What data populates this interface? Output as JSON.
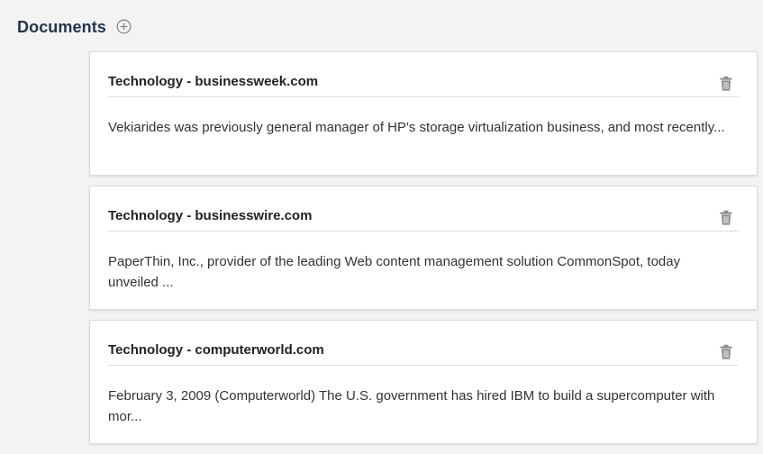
{
  "section": {
    "title": "Documents",
    "add_icon": "plus-circle-icon"
  },
  "documents": [
    {
      "title": "Technology - businessweek.com",
      "snippet": "Vekiarides was previously general manager of HP's storage virtualization business, and most recently...",
      "delete_icon": "trash-icon"
    },
    {
      "title": "Technology - businesswire.com",
      "snippet": "PaperThin, Inc., provider of the leading Web content management solution CommonSpot, today unveiled ...",
      "delete_icon": "trash-icon"
    },
    {
      "title": "Technology - computerworld.com",
      "snippet": "February 3, 2009 (Computerworld) The U.S. government has hired IBM to build a supercomputer with mor...",
      "delete_icon": "trash-icon"
    }
  ],
  "colors": {
    "background": "#f3f3f3",
    "title": "#23354d",
    "card": "#ffffff",
    "icon": "#8a8a8a"
  }
}
